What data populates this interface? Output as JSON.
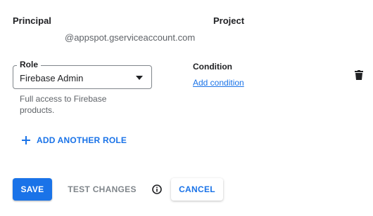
{
  "header": {
    "principal_label": "Principal",
    "project_label": "Project",
    "principal_value": "@appspot.gserviceaccount.com"
  },
  "role": {
    "label": "Role",
    "selected": "Firebase Admin",
    "description": "Full access to Firebase products."
  },
  "condition": {
    "label": "Condition",
    "add_link": "Add condition"
  },
  "actions": {
    "add_role": "ADD ANOTHER ROLE",
    "save": "SAVE",
    "test_changes": "TEST CHANGES",
    "cancel": "CANCEL"
  },
  "icons": {
    "delete": "trash-icon",
    "add": "plus-icon",
    "info": "info-icon",
    "dropdown": "chevron-down-icon"
  },
  "colors": {
    "accent": "#1a73e8",
    "text": "#202124",
    "muted": "#5f6368",
    "disabled": "#80868b"
  }
}
